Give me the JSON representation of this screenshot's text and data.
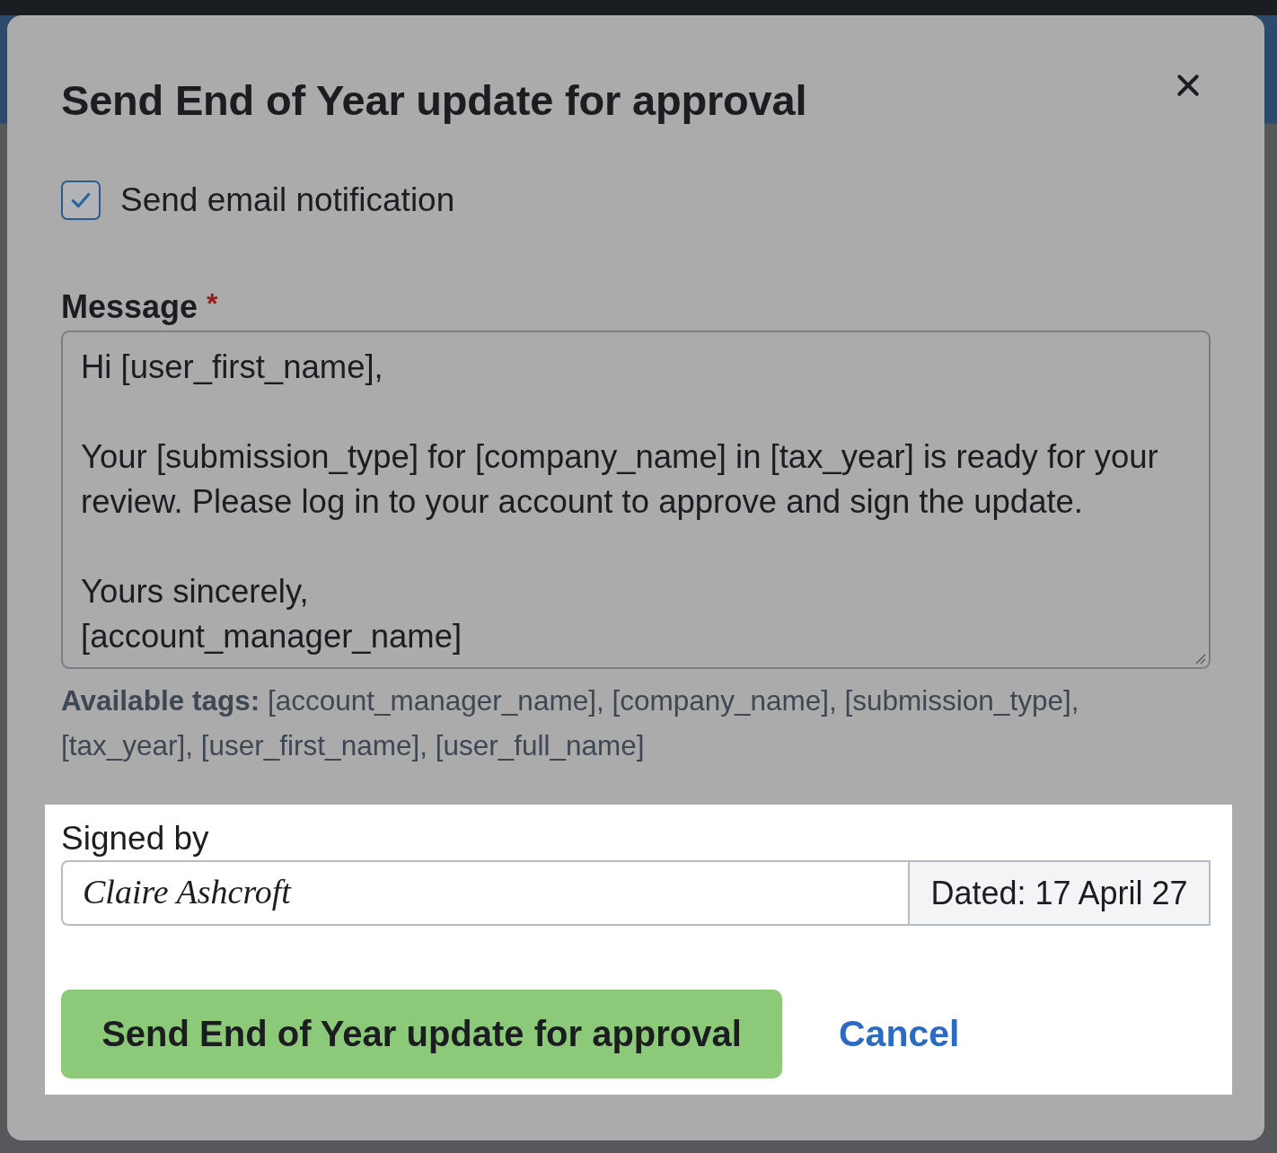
{
  "dialog": {
    "title": "Send End of Year update for approval"
  },
  "notification": {
    "label": "Send email notification",
    "checked": true
  },
  "message": {
    "label": "Message",
    "required_mark": "*",
    "value": "Hi [user_first_name],\n\nYour [submission_type] for [company_name] in [tax_year] is ready for your review. Please log in to your account to approve and sign the update.\n\nYours sincerely,\n[account_manager_name]"
  },
  "tags_hint": "**Available tags:** [account_manager_name], [company_name], [submission_type], [tax_year], [user_first_name], [user_full_name]",
  "signature": {
    "label": "Signed by",
    "value": "Claire Ashcroft",
    "addon": "Dated: 17 April 27"
  },
  "buttons": [
    {
      "kind": "primary",
      "label": "Send End of Year update for approval"
    },
    {
      "kind": "link",
      "label": "Cancel"
    }
  ]
}
